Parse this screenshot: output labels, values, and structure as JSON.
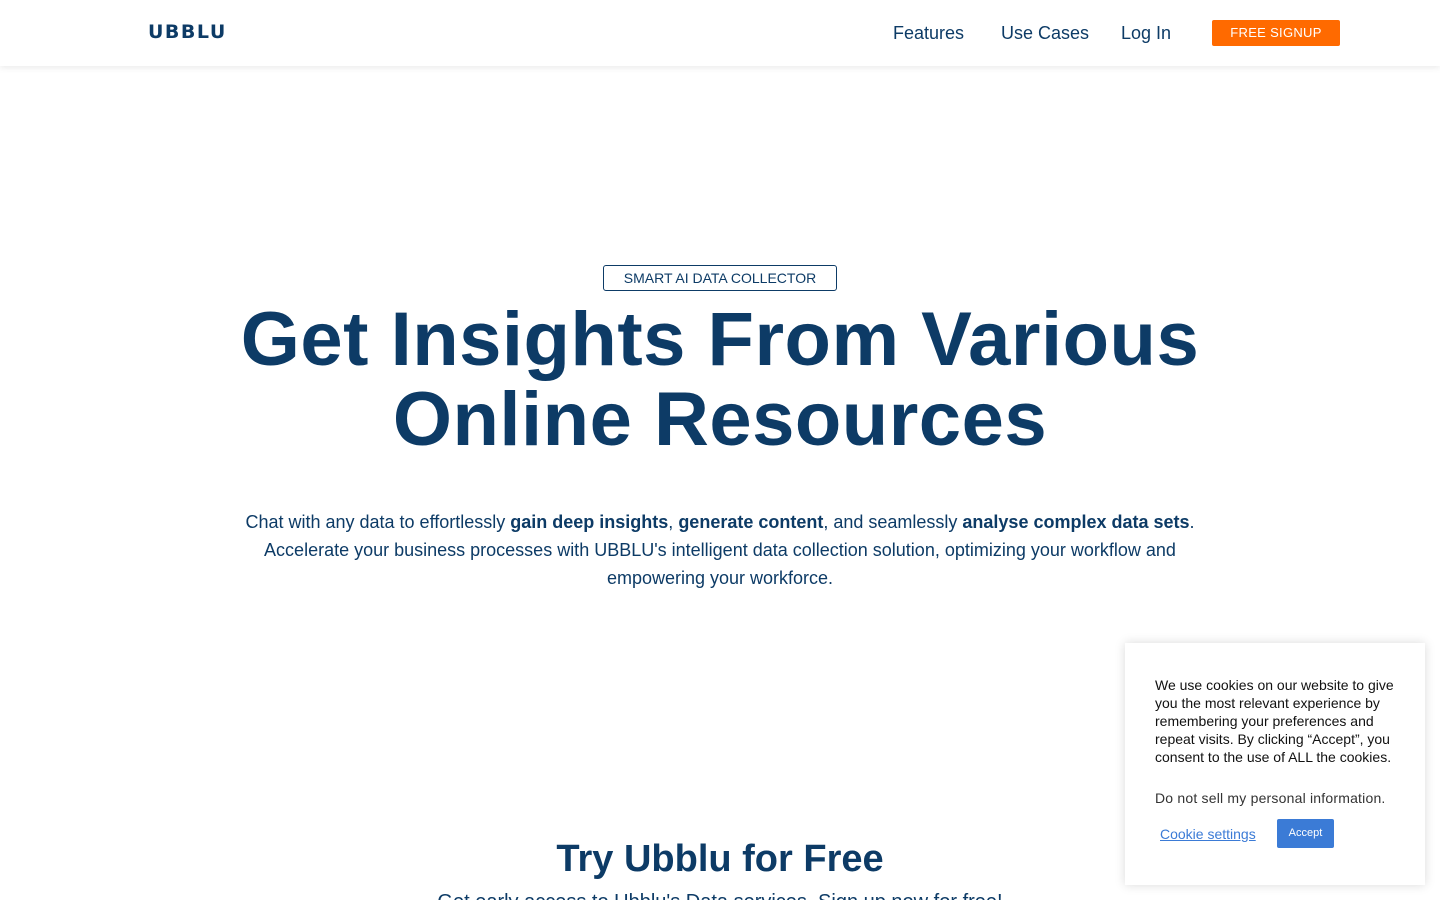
{
  "header": {
    "logo": "UBBLU",
    "nav": [
      "Features",
      "Use Cases",
      "Log In"
    ],
    "signup_label": "FREE SIGNUP",
    "colors": {
      "brand": "#0d3b66",
      "cta": "#ff6a00"
    }
  },
  "hero": {
    "badge": "SMART AI DATA COLLECTOR",
    "title_line1": "Get Insights From Various",
    "title_line2": "Online Resources",
    "desc": {
      "p1": "Chat with any data to effortlessly ",
      "b1": "gain deep insights",
      "p2": ", ",
      "b2": "generate content",
      "p3": ", and seamlessly ",
      "b3": "analyse complex data sets",
      "p4": ". Accelerate your business processes with UBBLU's intelligent data collection solution, optimizing your workflow and empowering your workforce."
    }
  },
  "try": {
    "title": "Try Ubblu for Free",
    "subtitle": "Get early access to Ubblu's Data services. Sign up now for free!"
  },
  "cookie": {
    "text": "We use cookies on our website to give you the most relevant experience by remembering your preferences and repeat visits. By clicking “Accept”, you consent to the use of ALL the cookies.",
    "do_not_sell": "Do not sell my personal information.",
    "settings_label": "Cookie settings",
    "accept_label": "Accept",
    "colors": {
      "accent": "#3b7bd6"
    }
  }
}
